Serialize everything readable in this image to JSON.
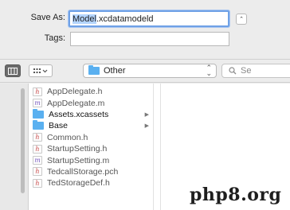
{
  "save_dialog": {
    "save_as_label": "Save As:",
    "filename_selected": "Model",
    "filename_rest": ".xcdatamodeld",
    "tags_label": "Tags:",
    "tags_value": "",
    "toggle_glyph": "⌃"
  },
  "toolbar": {
    "location": "Other",
    "search_placeholder": "Se",
    "view_columns_icon": "columns-view-icon",
    "view_grid_icon": "grid-view-icon"
  },
  "files": [
    {
      "name": "AppDelegate.h",
      "kind": "h",
      "arrow": false
    },
    {
      "name": "AppDelegate.m",
      "kind": "m",
      "arrow": false
    },
    {
      "name": "Assets.xcassets",
      "kind": "folder",
      "arrow": true
    },
    {
      "name": "Base",
      "kind": "folder",
      "arrow": true
    },
    {
      "name": "Common.h",
      "kind": "h",
      "arrow": false
    },
    {
      "name": "StartupSetting.h",
      "kind": "h",
      "arrow": false
    },
    {
      "name": "StartupSetting.m",
      "kind": "m",
      "arrow": false
    },
    {
      "name": "TedcallStorage.pch",
      "kind": "h",
      "arrow": false
    },
    {
      "name": "TedStorageDef.h",
      "kind": "h",
      "arrow": false
    }
  ],
  "watermark": "php8.org",
  "colors": {
    "accent": "#6fa1e6",
    "selection": "#b3d4fd",
    "folder": "#5ab0f0",
    "header_file": "#c94949",
    "impl_file": "#7d5fc3"
  }
}
